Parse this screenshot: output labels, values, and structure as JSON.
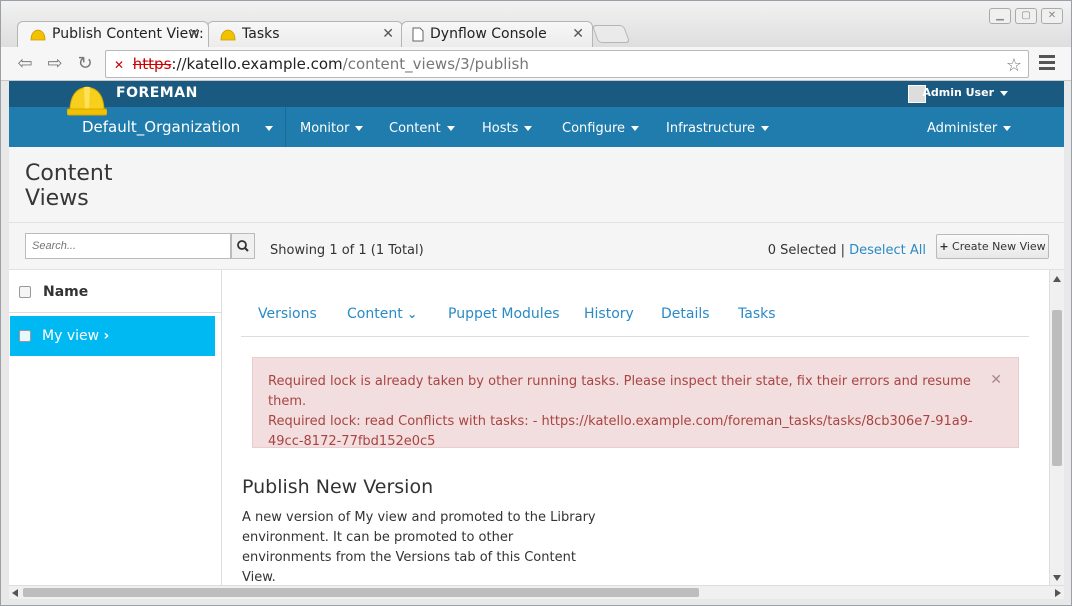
{
  "browser": {
    "tabs": [
      {
        "title": "Publish Content View:",
        "icon": "foreman-hat-icon"
      },
      {
        "title": "Tasks",
        "icon": "foreman-hat-icon"
      },
      {
        "title": "Dynflow Console",
        "icon": "page-icon"
      }
    ],
    "url": {
      "scheme": "https",
      "host": "://katello.example.com",
      "path": "/content_views/3/publish"
    }
  },
  "topbar": {
    "brand": "FOREMAN",
    "user": "Admin User"
  },
  "nav": {
    "organization": "Default_Organization",
    "items": [
      "Monitor",
      "Content",
      "Hosts",
      "Configure",
      "Infrastructure",
      "Administer"
    ]
  },
  "page": {
    "title": "Content Views",
    "search_placeholder": "Search...",
    "showing": "Showing 1 of 1 (1 Total)",
    "selected": "0 Selected |",
    "deselect_all": "Deselect All",
    "create_button": "Create New View"
  },
  "list": {
    "header": "Name",
    "rows": [
      {
        "label": "My view"
      }
    ]
  },
  "detail": {
    "tabs": [
      "Versions",
      "Content",
      "Puppet Modules",
      "History",
      "Details",
      "Tasks"
    ],
    "alert": {
      "line1": "Required lock is already taken by other running tasks. Please inspect their state, fix their errors and resume them.",
      "line2": "Required lock: read Conflicts with tasks: - https://katello.example.com/foreman_tasks/tasks/8cb306e7-91a9-49cc-8172-77fbd152e0c5"
    },
    "section_title": "Publish New Version",
    "section_text": "A new version of My view and promoted to the Library environment. It can be promoted to other environments from the Versions tab of this Content View."
  },
  "colors": {
    "topbar": "#1a5a80",
    "nav": "#1f7cad",
    "selected_row": "#00b9f2",
    "link": "#2a8ac5",
    "alert_bg": "#f2dede",
    "alert_text": "#a94442"
  }
}
